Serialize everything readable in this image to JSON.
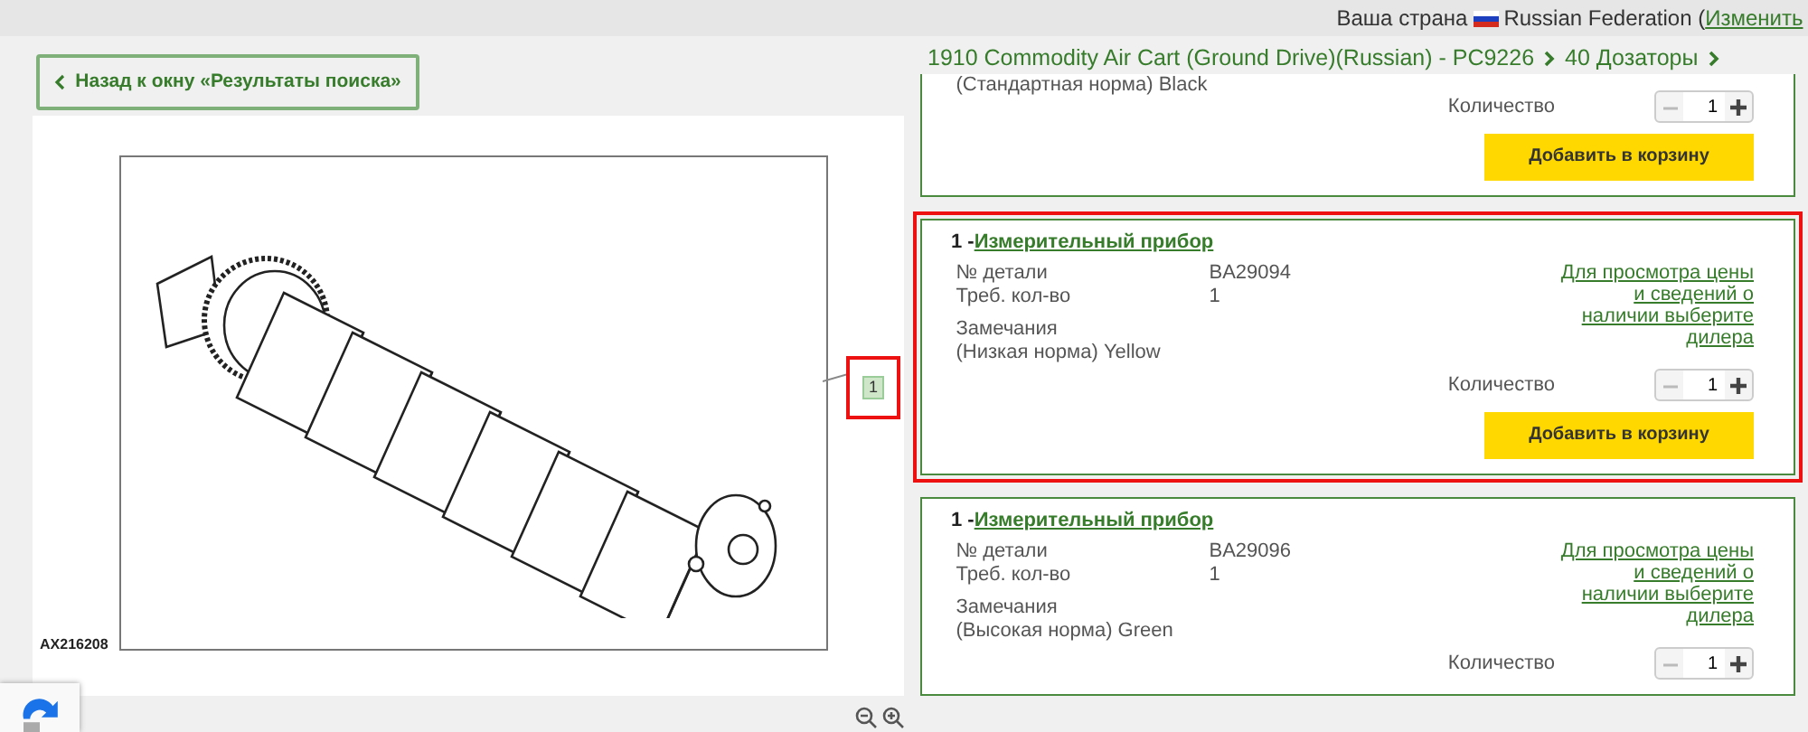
{
  "top_bar": {
    "country_label": "Ваша страна",
    "country": "Russian Federation (",
    "change_link": "Изменить"
  },
  "back_button": {
    "label": "Назад к окну «Результаты поиска»"
  },
  "diagram": {
    "image_code": "AX216208",
    "callouts": [
      {
        "label": "1",
        "selected": true
      }
    ]
  },
  "breadcrumb": [
    {
      "label": "1910 Commodity Air Cart (Ground Drive)(Russian) - PC9226"
    },
    {
      "label": "40 Дозаторы"
    }
  ],
  "parts": [
    {
      "selected": false,
      "remarks": "(Стандартная норма) Black",
      "quantity_label": "Количество",
      "quantity": "1",
      "add_button": "Добавить в корзину"
    },
    {
      "selected": true,
      "item_number": "1 -",
      "name": "Измерительный прибор",
      "part_no_label": "№ детали",
      "part_no": "BA29094",
      "qty_label": "Треб. кол-во",
      "qty": "1",
      "remarks_label": "Замечания",
      "remarks": "(Низкая норма) Yellow",
      "price_link": "Для просмотра цены и сведений о наличии выберите дилера",
      "quantity_label": "Количество",
      "quantity": "1",
      "add_button": "Добавить в корзину"
    },
    {
      "selected": false,
      "item_number": "1 -",
      "name": "Измерительный прибор",
      "part_no_label": "№ детали",
      "part_no": "BA29096",
      "qty_label": "Треб. кол-во",
      "qty": "1",
      "remarks_label": "Замечания",
      "remarks": "(Высокая норма) Green",
      "price_link": "Для просмотра цены и сведений о наличии выберите дилера",
      "quantity_label": "Количество",
      "quantity": "1"
    }
  ]
}
